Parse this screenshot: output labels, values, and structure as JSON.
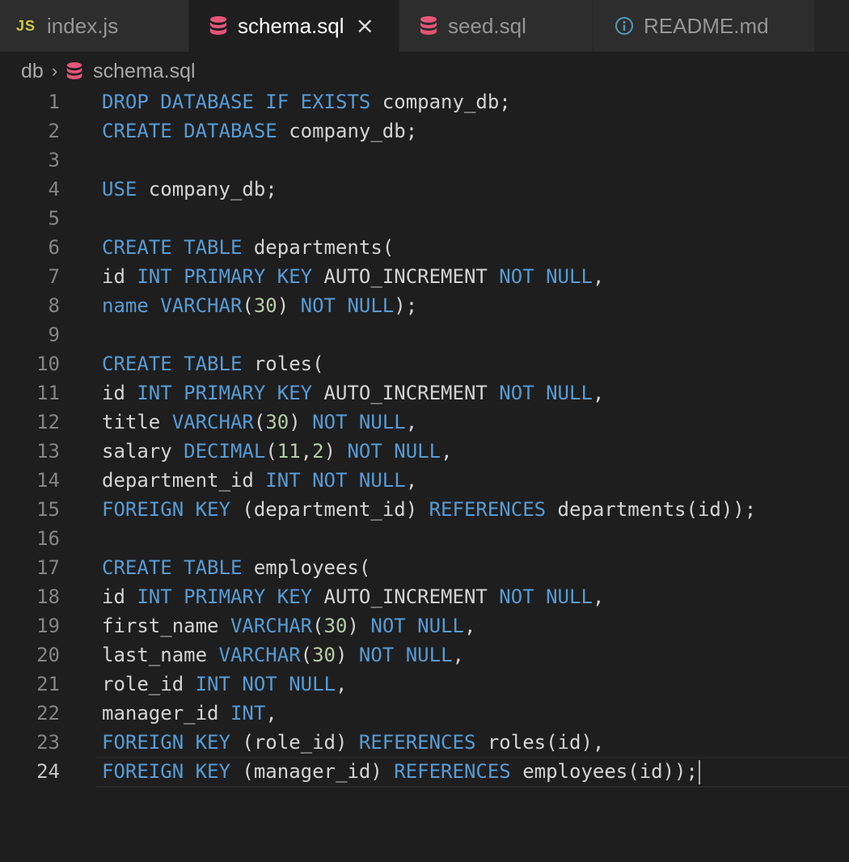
{
  "tabs": [
    {
      "icon": "js-icon",
      "icon_text": "JS",
      "label": "index.js",
      "active": false
    },
    {
      "icon": "database-icon",
      "label": "schema.sql",
      "active": true,
      "close": "×"
    },
    {
      "icon": "database-icon",
      "label": "seed.sql",
      "active": false
    },
    {
      "icon": "info-icon",
      "label": "README.md",
      "active": false
    }
  ],
  "breadcrumb": {
    "folder": "db",
    "separator": "›",
    "file": "schema.sql"
  },
  "colors": {
    "keyword": "#569cd6",
    "number": "#b5cea8",
    "text": "#d4d4d4",
    "db_icon": "#e8547a",
    "js_icon": "#cbcb41",
    "info_icon": "#519aba"
  },
  "editor": {
    "current_line": 24,
    "lines": [
      {
        "n": "1",
        "tokens": [
          {
            "t": "DROP DATABASE IF EXISTS",
            "c": "kw"
          },
          {
            "t": " company_db;",
            "c": "txt"
          }
        ]
      },
      {
        "n": "2",
        "tokens": [
          {
            "t": "CREATE DATABASE",
            "c": "kw"
          },
          {
            "t": " company_db;",
            "c": "txt"
          }
        ]
      },
      {
        "n": "3",
        "tokens": []
      },
      {
        "n": "4",
        "tokens": [
          {
            "t": "USE",
            "c": "kw"
          },
          {
            "t": " company_db;",
            "c": "txt"
          }
        ]
      },
      {
        "n": "5",
        "tokens": []
      },
      {
        "n": "6",
        "tokens": [
          {
            "t": "CREATE TABLE",
            "c": "kw"
          },
          {
            "t": " departments(",
            "c": "txt"
          }
        ]
      },
      {
        "n": "7",
        "tokens": [
          {
            "t": "id ",
            "c": "txt"
          },
          {
            "t": "INT PRIMARY KEY",
            "c": "kw"
          },
          {
            "t": " AUTO_INCREMENT ",
            "c": "txt"
          },
          {
            "t": "NOT NULL",
            "c": "kw"
          },
          {
            "t": ",",
            "c": "txt"
          }
        ]
      },
      {
        "n": "8",
        "tokens": [
          {
            "t": "name VARCHAR",
            "c": "kw"
          },
          {
            "t": "(",
            "c": "txt"
          },
          {
            "t": "30",
            "c": "num"
          },
          {
            "t": ") ",
            "c": "txt"
          },
          {
            "t": "NOT NULL",
            "c": "kw"
          },
          {
            "t": ");",
            "c": "txt"
          }
        ]
      },
      {
        "n": "9",
        "tokens": []
      },
      {
        "n": "10",
        "tokens": [
          {
            "t": "CREATE TABLE",
            "c": "kw"
          },
          {
            "t": " roles(",
            "c": "txt"
          }
        ]
      },
      {
        "n": "11",
        "tokens": [
          {
            "t": "id ",
            "c": "txt"
          },
          {
            "t": "INT PRIMARY KEY",
            "c": "kw"
          },
          {
            "t": " AUTO_INCREMENT ",
            "c": "txt"
          },
          {
            "t": "NOT NULL",
            "c": "kw"
          },
          {
            "t": ",",
            "c": "txt"
          }
        ]
      },
      {
        "n": "12",
        "tokens": [
          {
            "t": "title ",
            "c": "txt"
          },
          {
            "t": "VARCHAR",
            "c": "kw"
          },
          {
            "t": "(",
            "c": "txt"
          },
          {
            "t": "30",
            "c": "num"
          },
          {
            "t": ") ",
            "c": "txt"
          },
          {
            "t": "NOT NULL",
            "c": "kw"
          },
          {
            "t": ",",
            "c": "txt"
          }
        ]
      },
      {
        "n": "13",
        "tokens": [
          {
            "t": "salary ",
            "c": "txt"
          },
          {
            "t": "DECIMAL",
            "c": "kw"
          },
          {
            "t": "(",
            "c": "txt"
          },
          {
            "t": "11",
            "c": "num"
          },
          {
            "t": ",",
            "c": "txt"
          },
          {
            "t": "2",
            "c": "num"
          },
          {
            "t": ") ",
            "c": "txt"
          },
          {
            "t": "NOT NULL",
            "c": "kw"
          },
          {
            "t": ",",
            "c": "txt"
          }
        ]
      },
      {
        "n": "14",
        "tokens": [
          {
            "t": "department_id ",
            "c": "txt"
          },
          {
            "t": "INT NOT NULL",
            "c": "kw"
          },
          {
            "t": ",",
            "c": "txt"
          }
        ]
      },
      {
        "n": "15",
        "tokens": [
          {
            "t": "FOREIGN KEY",
            "c": "kw"
          },
          {
            "t": " (department_id) ",
            "c": "txt"
          },
          {
            "t": "REFERENCES",
            "c": "kw"
          },
          {
            "t": " departments(id));",
            "c": "txt"
          }
        ]
      },
      {
        "n": "16",
        "tokens": []
      },
      {
        "n": "17",
        "tokens": [
          {
            "t": "CREATE TABLE",
            "c": "kw"
          },
          {
            "t": " employees(",
            "c": "txt"
          }
        ]
      },
      {
        "n": "18",
        "tokens": [
          {
            "t": "id ",
            "c": "txt"
          },
          {
            "t": "INT PRIMARY KEY",
            "c": "kw"
          },
          {
            "t": " AUTO_INCREMENT ",
            "c": "txt"
          },
          {
            "t": "NOT NULL",
            "c": "kw"
          },
          {
            "t": ",",
            "c": "txt"
          }
        ]
      },
      {
        "n": "19",
        "tokens": [
          {
            "t": "first_name ",
            "c": "txt"
          },
          {
            "t": "VARCHAR",
            "c": "kw"
          },
          {
            "t": "(",
            "c": "txt"
          },
          {
            "t": "30",
            "c": "num"
          },
          {
            "t": ") ",
            "c": "txt"
          },
          {
            "t": "NOT NULL",
            "c": "kw"
          },
          {
            "t": ",",
            "c": "txt"
          }
        ]
      },
      {
        "n": "20",
        "tokens": [
          {
            "t": "last_name ",
            "c": "txt"
          },
          {
            "t": "VARCHAR",
            "c": "kw"
          },
          {
            "t": "(",
            "c": "txt"
          },
          {
            "t": "30",
            "c": "num"
          },
          {
            "t": ") ",
            "c": "txt"
          },
          {
            "t": "NOT NULL",
            "c": "kw"
          },
          {
            "t": ",",
            "c": "txt"
          }
        ]
      },
      {
        "n": "21",
        "tokens": [
          {
            "t": "role_id ",
            "c": "txt"
          },
          {
            "t": "INT NOT NULL",
            "c": "kw"
          },
          {
            "t": ",",
            "c": "txt"
          }
        ]
      },
      {
        "n": "22",
        "tokens": [
          {
            "t": "manager_id ",
            "c": "txt"
          },
          {
            "t": "INT",
            "c": "kw"
          },
          {
            "t": ",",
            "c": "txt"
          }
        ]
      },
      {
        "n": "23",
        "tokens": [
          {
            "t": "FOREIGN KEY",
            "c": "kw"
          },
          {
            "t": " (role_id) ",
            "c": "txt"
          },
          {
            "t": "REFERENCES",
            "c": "kw"
          },
          {
            "t": " roles(id),",
            "c": "txt"
          }
        ]
      },
      {
        "n": "24",
        "tokens": [
          {
            "t": "FOREIGN KEY",
            "c": "kw"
          },
          {
            "t": " (manager_id) ",
            "c": "txt"
          },
          {
            "t": "REFERENCES",
            "c": "kw"
          },
          {
            "t": " employees(id));",
            "c": "txt"
          }
        ]
      }
    ]
  }
}
